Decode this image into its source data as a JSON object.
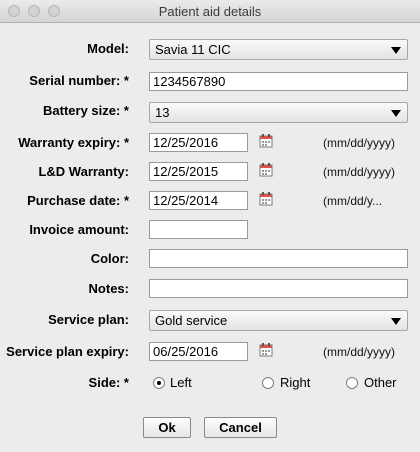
{
  "window": {
    "title": "Patient aid details"
  },
  "form": {
    "model": {
      "label": "Model:",
      "value": "Savia 11 CIC"
    },
    "serial_number": {
      "label": "Serial number: *",
      "value": "1234567890"
    },
    "battery_size": {
      "label": "Battery size: *",
      "value": "13"
    },
    "warranty_expiry": {
      "label": "Warranty expiry: *",
      "value": "12/25/2016",
      "hint": "(mm/dd/yyyy)"
    },
    "ld_warranty": {
      "label": "L&D Warranty:",
      "value": "12/25/2015",
      "hint": "(mm/dd/yyyy)"
    },
    "purchase_date": {
      "label": "Purchase date: *",
      "value": "12/25/2014",
      "hint": "(mm/dd/y..."
    },
    "invoice_amount": {
      "label": "Invoice amount:",
      "value": ""
    },
    "color": {
      "label": "Color:",
      "value": ""
    },
    "notes": {
      "label": "Notes:",
      "value": ""
    },
    "service_plan": {
      "label": "Service plan:",
      "value": "Gold service"
    },
    "service_plan_expiry": {
      "label": "Service plan expiry:",
      "value": "06/25/2016",
      "hint": "(mm/dd/yyyy)"
    },
    "side": {
      "label": "Side: *",
      "options": [
        "Left",
        "Right",
        "Other"
      ],
      "selected": "Left"
    }
  },
  "buttons": {
    "ok": "Ok",
    "cancel": "Cancel"
  },
  "icons": {
    "calendar": "calendar-icon",
    "dropdown": "chevron-down-icon"
  },
  "colors": {
    "background": "#ececec",
    "calendar_accent": "#d9534f"
  }
}
